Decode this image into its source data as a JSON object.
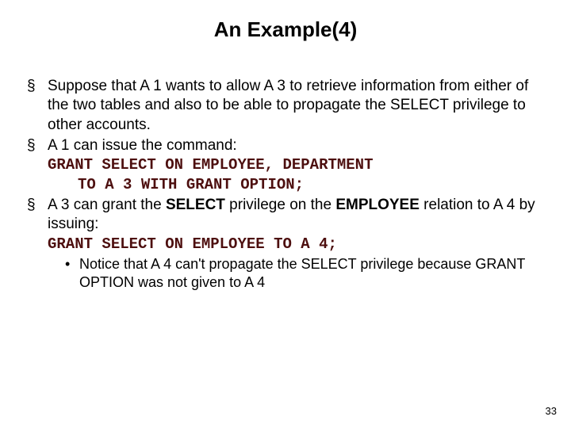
{
  "title": "An Example(4)",
  "b1": "Suppose that A 1 wants to allow A 3 to retrieve information from either of the two tables and also to be able to propagate the SELECT privilege to other accounts.",
  "b2": "A 1 can issue the command:",
  "c1a": "GRANT SELECT ON ",
  "c1b": "EMPLOYEE, DEPARTMENT",
  "c2a": "TO ",
  "c2b": "A 3 ",
  "c2c": "WITH GRANT OPTION;",
  "b3a": "A 3 can grant the ",
  "b3b": "SELECT",
  "b3c": " privilege on the ",
  "b3d": "EMPLOYEE",
  "b3e": " relation to A 4 by issuing:",
  "c3a": "GRANT SELECT ON ",
  "c3b": "EMPLOYEE ",
  "c3c": "TO ",
  "c3d": "A 4;",
  "s1": "Notice that A 4 can't propagate the SELECT privilege because GRANT OPTION was not given to A 4",
  "page": "33"
}
